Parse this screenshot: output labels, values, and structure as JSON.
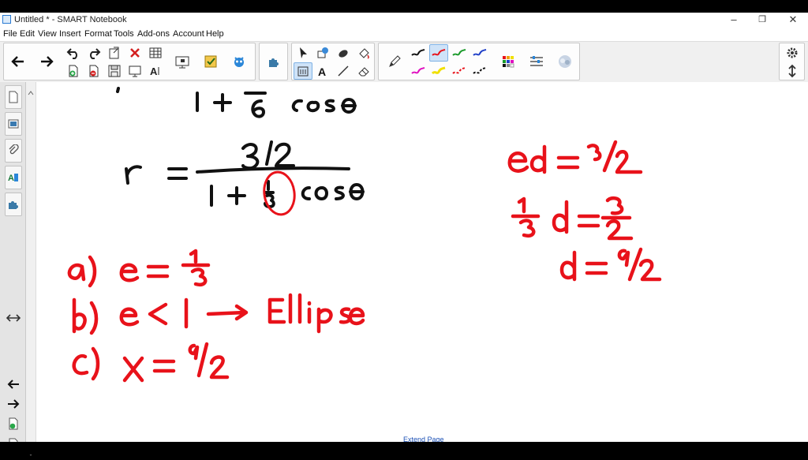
{
  "window": {
    "title": "Untitled * - SMART Notebook",
    "minimize": "–",
    "restore": "❐",
    "close": "✕"
  },
  "menu": [
    "File",
    "Edit",
    "View",
    "Insert",
    "Format",
    "Tools",
    "Add-ons",
    "Account",
    "Help"
  ],
  "canvas": {
    "extend_link": "Extend Page"
  },
  "colors": {
    "red_ink": "#e8121a",
    "black_ink": "#111111",
    "pen_colors": [
      "#111111",
      "#e8121a",
      "#1a9a2a",
      "#2040c8",
      "#e010c0",
      "#f0e000",
      "#e8121a",
      "#111111"
    ]
  },
  "icons": {
    "toolbar": [
      "back-arrow-icon",
      "forward-arrow-icon",
      "undo-icon",
      "redo-icon",
      "paste-icon",
      "delete-icon",
      "table-icon",
      "add-page-icon",
      "print-icon",
      "save-icon",
      "screen-share-icon",
      "text-icon",
      "document-camera-icon",
      "checkmark-icon",
      "addon-icon",
      "select-icon",
      "shapes-icon",
      "eraser-icon",
      "fill-icon",
      "pen-icon",
      "line-icon",
      "color-palette-icon",
      "properties-icon",
      "gallery-icon",
      "gear-icon"
    ],
    "sidebar": [
      "page-sorter-icon",
      "gallery-tab-icon",
      "attachments-icon",
      "properties-tab-icon",
      "addons-tab-icon",
      "move-sidebar-icon",
      "previous-page-icon",
      "next-page-icon",
      "add-page-tab-icon",
      "delete-page-tab-icon"
    ]
  }
}
